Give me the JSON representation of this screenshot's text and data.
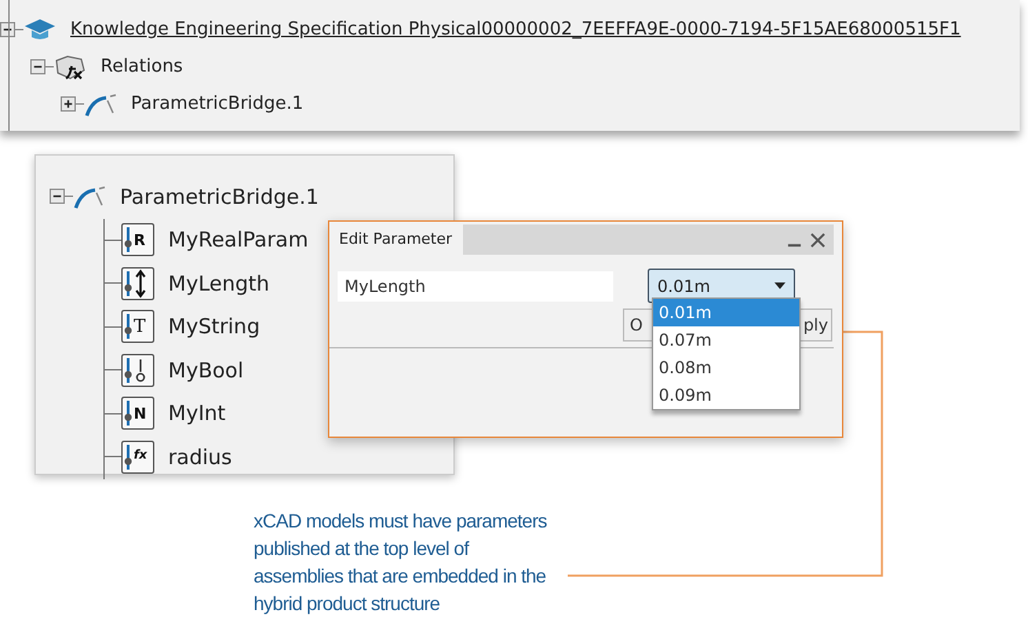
{
  "top_tree": [
    {
      "label": "Knowledge Engineering Specification Physical00000002_7EEFFA9E-0000-7194-5F15AE68000515F1",
      "kind": "knowledge",
      "expanded": true,
      "children": [
        {
          "label": "Relations",
          "kind": "relations",
          "expanded": true,
          "children": [
            {
              "label": "ParametricBridge.1",
              "kind": "bridge",
              "expanded": false
            }
          ]
        }
      ]
    }
  ],
  "bottom_tree": [
    {
      "label": "ParametricBridge.1",
      "kind": "bridge",
      "expanded": true,
      "children": [
        {
          "label": "MyRealParam",
          "kind": "real",
          "icon_text": "R"
        },
        {
          "label": "MyLength",
          "kind": "length"
        },
        {
          "label": "MyString",
          "kind": "string",
          "icon_text": "T"
        },
        {
          "label": "MyBool",
          "kind": "bool"
        },
        {
          "label": "MyInt",
          "kind": "int",
          "icon_text": "N"
        },
        {
          "label": "radius",
          "kind": "formula",
          "icon_text": "fx"
        }
      ]
    }
  ],
  "dialog": {
    "title": "Edit Parameter",
    "field_value": "MyLength",
    "combo_value": "0.01m",
    "options": [
      {
        "label": "0.01m",
        "selected": true
      },
      {
        "label": "0.07m",
        "selected": false
      },
      {
        "label": "0.08m",
        "selected": false
      },
      {
        "label": "0.09m",
        "selected": false
      }
    ],
    "buttons": [
      "O",
      "ply"
    ]
  },
  "note": [
    "xCAD models must have parameters",
    "published at the top level of",
    "assemblies that are embedded in the",
    "hybrid product structure"
  ]
}
